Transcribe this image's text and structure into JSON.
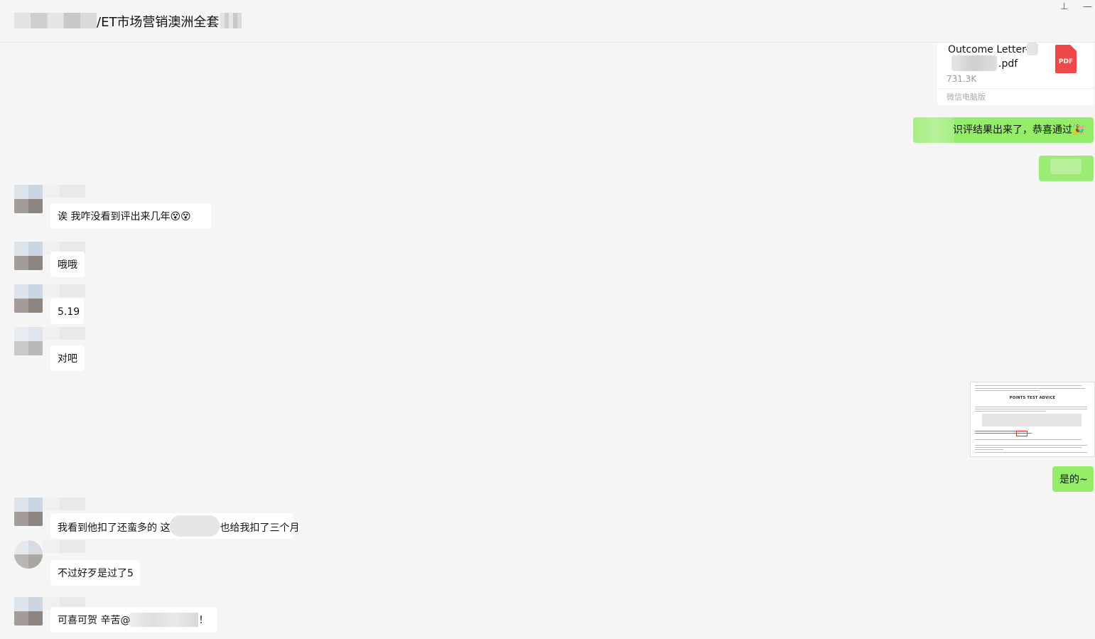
{
  "window": {
    "title_visible": "/ET市场营销澳洲全套",
    "pin_icon": "pin-icon",
    "minimize_icon": "minimize-icon",
    "pin_glyph": "⊥",
    "minimize_glyph": "—"
  },
  "file_message": {
    "name_line1": "Outcome Letter-",
    "name_line2": ".pdf",
    "size": "731.3K",
    "source": "微信电脑版",
    "icon_label": "PDF",
    "icon_color": "#f04848"
  },
  "messages": [
    {
      "side": "out",
      "text": "识评结果出来了，恭喜通过🎉"
    },
    {
      "side": "out",
      "text": ""
    },
    {
      "side": "in",
      "text": "诶 我咋没看到评出来几年😵😵"
    },
    {
      "side": "in",
      "text": "哦哦"
    },
    {
      "side": "in",
      "text": "5.19"
    },
    {
      "side": "in",
      "text": "对吧"
    },
    {
      "side": "out",
      "text": "是的~"
    },
    {
      "side": "in",
      "text": "我看到他扣了还蛮多的 这",
      "text_after": "也给我扣了三个月"
    },
    {
      "side": "in",
      "text": "不过好歹是过了5"
    },
    {
      "side": "in",
      "text": "可喜可贺 辛苦@",
      "text_after": "！"
    }
  ],
  "doc_image": {
    "heading": "POINTS TEST ADVICE"
  },
  "colors": {
    "outgoing_bubble": "#95ec69",
    "incoming_bubble": "#ffffff",
    "background": "#f5f5f5"
  }
}
